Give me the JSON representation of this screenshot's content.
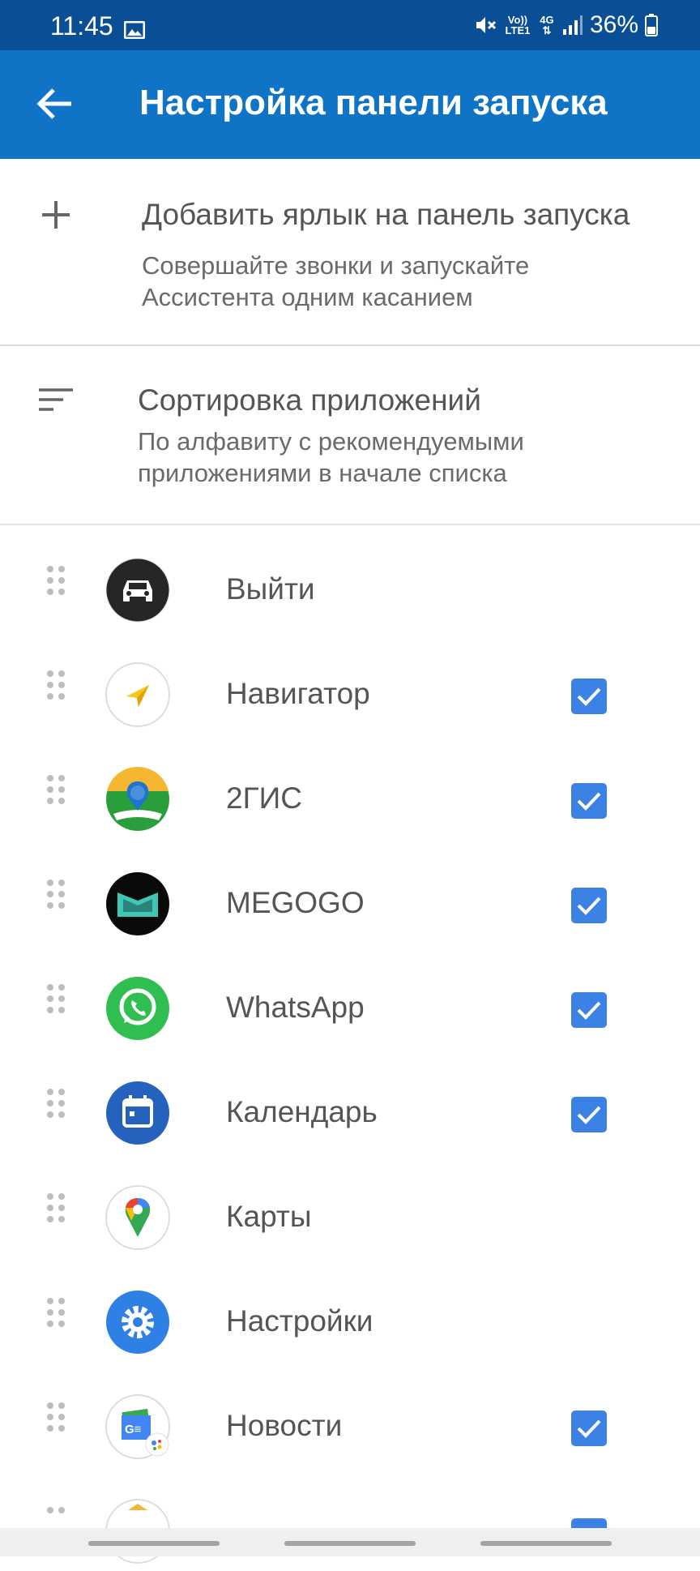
{
  "status_bar": {
    "time": "11:45",
    "network": "4G",
    "volte": "Vo)) LTE1",
    "battery": "36%"
  },
  "app_bar": {
    "title": "Настройка панели запуска"
  },
  "add_shortcut": {
    "title": "Добавить ярлык на панель запуска",
    "subtitle": "Совершайте звонки и запускайте Ассистента одним касанием"
  },
  "sort": {
    "title": "Сортировка приложений",
    "subtitle": "По алфавиту с рекомендуемыми приложениями в начале списка"
  },
  "apps": [
    {
      "label": "Выйти",
      "checked": false,
      "icon": "car-icon"
    },
    {
      "label": " Навигатор",
      "checked": true,
      "icon": "navigator-icon"
    },
    {
      "label": "2ГИС",
      "checked": true,
      "icon": "2gis-icon"
    },
    {
      "label": "MEGOGO",
      "checked": true,
      "icon": "megogo-icon"
    },
    {
      "label": "WhatsApp",
      "checked": true,
      "icon": "whatsapp-icon"
    },
    {
      "label": "Календарь",
      "checked": true,
      "icon": "calendar-icon"
    },
    {
      "label": "Карты",
      "checked": false,
      "icon": "maps-icon"
    },
    {
      "label": "Настройки",
      "checked": false,
      "icon": "settings-icon"
    },
    {
      "label": "Новости",
      "checked": true,
      "icon": "news-icon"
    }
  ],
  "colors": {
    "status_bar": "#0a4f96",
    "app_bar": "#0f73c6",
    "checkbox": "#3b82e4"
  }
}
